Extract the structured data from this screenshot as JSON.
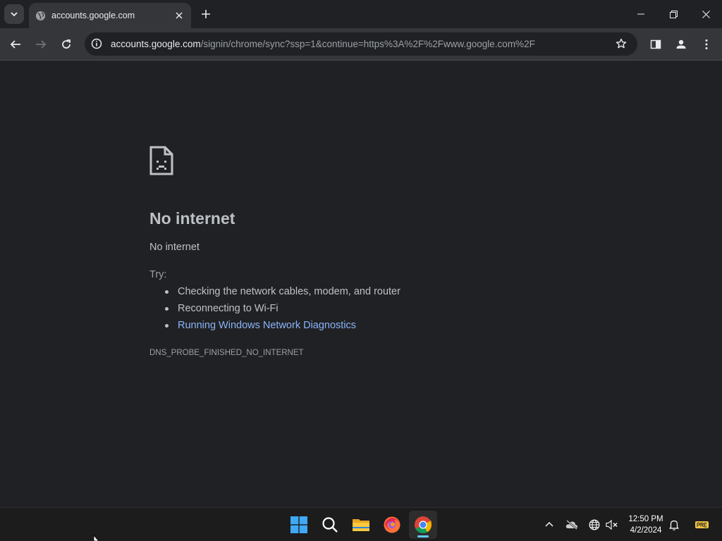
{
  "browser": {
    "tab": {
      "title": "accounts.google.com"
    },
    "omnibox": {
      "host": "accounts.google.com",
      "path": "/signin/chrome/sync?ssp=1&continue=https%3A%2F%2Fwww.google.com%2F"
    }
  },
  "error_page": {
    "title": "No internet",
    "subtitle": "No internet",
    "try_label": "Try:",
    "suggestions": [
      "Checking the network cables, modem, and router",
      "Reconnecting to Wi-Fi"
    ],
    "diagnostics_link": "Running Windows Network Diagnostics",
    "error_code": "DNS_PROBE_FINISHED_NO_INTERNET"
  },
  "taskbar": {
    "apps": [
      "windows-start",
      "search",
      "file-explorer",
      "firefox",
      "chrome"
    ],
    "active_app": "chrome",
    "clock": {
      "time": "12:50 PM",
      "date": "4/2/2024"
    },
    "tray_icons": [
      "chevron-up-icon",
      "onedrive-offline-icon",
      "globe-icon",
      "speaker-muted-icon",
      "bell-icon",
      "pre-badge-icon"
    ]
  },
  "colors": {
    "background": "#202124",
    "toolbar": "#35363a",
    "link": "#8ab4f8",
    "text": "#bdc1c6"
  }
}
